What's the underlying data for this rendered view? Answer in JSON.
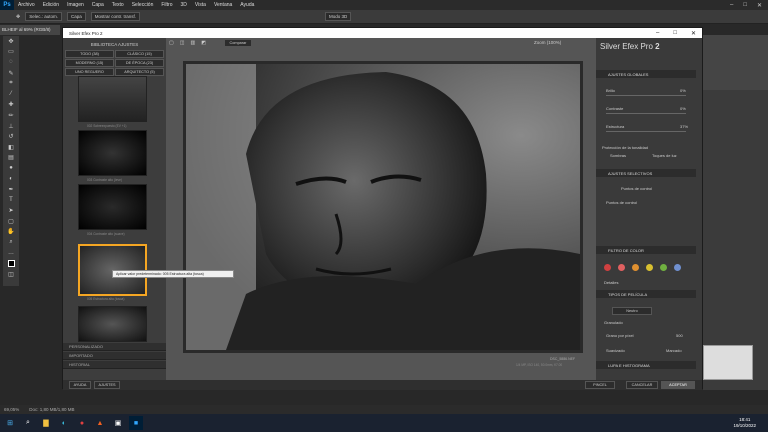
{
  "menubar": {
    "logo": "Ps",
    "items": [
      "Archivo",
      "Edición",
      "Imagen",
      "Capa",
      "Texto",
      "Selección",
      "Filtro",
      "3D",
      "Vista",
      "Ventana",
      "Ayuda"
    ]
  },
  "optbar": {
    "selec_label": "Selec.: autom.",
    "selec_value": "Capa",
    "show_transform": "Mostrar contr. transf.",
    "mode3d": "Modo 3D"
  },
  "doc_tab": "BLHEIF al 69% (RGB/8)",
  "plugin": {
    "title": "Silver Efex Pro 2",
    "brand_name": "Silver Efex Pro",
    "brand_version": "2",
    "compare": "Comparar",
    "zoom": "Zoom (100%)",
    "preset_library": "BIBLIOTECA AJUSTES",
    "filters": [
      "TODO (38)",
      "CLÁSICO (15)",
      "MODERNO (15)",
      "DE ÉPOCA (23)",
      "UNO REGUERO",
      "ARQUITECTO (5)"
    ],
    "presets": [
      "002 Sobreexpuesto (EV +1)",
      "003 Contraste alto (leve)",
      "004 Contraste alto (suave)",
      "005 Estructura alta (tosca)",
      ""
    ],
    "tooltip": "Aplicar valor predeterminado: 005 Estructura alta (tosca)",
    "bottom_sections": [
      "PERSONALIZADO",
      "IMPORTADO",
      "HISTORIAL"
    ],
    "help": "AYUDA",
    "settings": "AJUSTES",
    "image_info": {
      "name": "DSC_5886.NEF",
      "meta": "1/4 MP, ISO 140, 50.0mm, f/7.00"
    },
    "global_adjust": "AJUSTES GLOBALES",
    "sliders": [
      {
        "label": "Brillo",
        "value": "0%"
      },
      {
        "label": "Contraste",
        "value": "0%"
      },
      {
        "label": "Estructura",
        "value": "37%"
      }
    ],
    "tonal_protection": "Protección de la tonalidad",
    "shadows": "Sombras",
    "highlights": "Toques de luz",
    "selective_adjust": "AJUSTES SELECTIVOS",
    "control_points": "Puntos de control",
    "control_points2": "Puntos de control",
    "color_filter": "FILTRO DE COLOR",
    "filter_colors": [
      "#d04040",
      "#e06060",
      "#e09030",
      "#d8c030",
      "#70b040",
      "#7090d0"
    ],
    "details": "Detalles",
    "film_types": "TIPOS DE PELÍCULA",
    "film_select": "Neutro",
    "grain": "Granulado",
    "grain_per_pixel": "Grano por píxel",
    "grain_value": "500",
    "soft": "Suavizado",
    "marked": "Marcado",
    "loupe": "LUPA E HISTOGRAMA",
    "cancel": "CANCELAR",
    "accept": "ACEPTAR",
    "brush": "PINCEL"
  },
  "status": {
    "zoom": "69,05%",
    "doc": "Doc: 1,80 MB/1,80 MB"
  },
  "taskbar": {
    "time": "18:41",
    "date": "19/10/2022"
  },
  "colors": {
    "accent": "#f5a623",
    "accept_bg": "#3a3a3a"
  }
}
